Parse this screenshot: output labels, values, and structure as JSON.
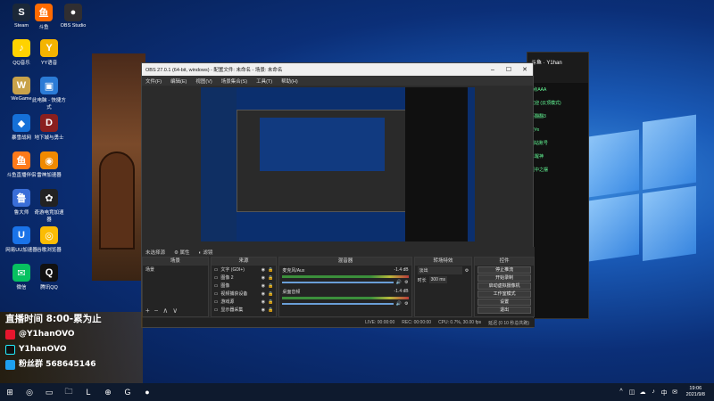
{
  "desktop": {
    "icons": [
      {
        "label": "Steam",
        "glyph": "S",
        "color": "#1b2838"
      },
      {
        "label": "斗鱼",
        "glyph": "鱼",
        "color": "#ff6a00"
      },
      {
        "label": "OBS Studio",
        "glyph": "●",
        "color": "#302e31"
      },
      {
        "label": "QQ音乐",
        "glyph": "♪",
        "color": "#ffd200"
      },
      {
        "label": "YY语音",
        "glyph": "Y",
        "color": "#f4b400"
      },
      {
        "label": "WeGame",
        "glyph": "W",
        "color": "#c8a24a"
      },
      {
        "label": "此电脑 - 快捷方式",
        "glyph": "▣",
        "color": "#2b7bd6"
      },
      {
        "label": "暴雪战网",
        "glyph": "◆",
        "color": "#1570d8"
      },
      {
        "label": "地下城与勇士",
        "glyph": "D",
        "color": "#8a1f1f"
      },
      {
        "label": "斗鱼直播伴侣",
        "glyph": "鱼",
        "color": "#ff7a1a"
      },
      {
        "label": "雷神加速器",
        "glyph": "◉",
        "color": "#f08a00"
      },
      {
        "label": "鲁大师",
        "glyph": "鲁",
        "color": "#3a6ed8"
      },
      {
        "label": "奇游电竞加速器",
        "glyph": "✿",
        "color": "#222"
      },
      {
        "label": "网易UU加速器",
        "glyph": "U",
        "color": "#1a73e8"
      },
      {
        "label": "谷歌浏览器",
        "glyph": "◎",
        "color": "#fbbc05"
      },
      {
        "label": "微信",
        "glyph": "✉",
        "color": "#07c160"
      },
      {
        "label": "腾讯QQ",
        "glyph": "Q",
        "color": "#111"
      }
    ]
  },
  "chat_window": {
    "title": "斗鱼 · Y1han",
    "lines": [
      "A点AAA",
      "欢迎 (云顶模式)",
      "蔡翻翻3",
      "空#x",
      "网站账号",
      "三醒神",
      "驱中之摆"
    ]
  },
  "obs": {
    "title": "OBS 27.0.1 (64-bit, windows) - 配置文件: 未命名 - 场景: 未命名",
    "menu": [
      "文件(F)",
      "编辑(E)",
      "视图(V)",
      "场景集合(S)",
      "工具(T)",
      "帮助(H)"
    ],
    "bar": [
      "未选择源",
      "属性",
      "滤镜"
    ],
    "docks": {
      "scenes": {
        "title": "场景",
        "items": [
          "场景"
        ]
      },
      "sources": {
        "title": "来源",
        "items": [
          "文字 (GDI+)",
          "图像 2",
          "图像",
          "视频捕获设备",
          "游戏源",
          "显示器采集"
        ]
      },
      "mixer": {
        "title": "混音器",
        "channels": [
          {
            "name": "麦克风/Aux",
            "db": "-1.4 dB"
          },
          {
            "name": "桌面音频",
            "db": "-1.4 dB"
          }
        ]
      },
      "transitions": {
        "title": "转场特效",
        "value": "淡出",
        "duration_label": "时长",
        "duration": "300 ms"
      },
      "controls": {
        "title": "控件",
        "buttons": [
          "停止推流",
          "开始录制",
          "启动虚拟摄像机",
          "工作室模式",
          "设置",
          "退出"
        ]
      }
    },
    "status": [
      "LIVE: 00:00:00",
      "REC: 00:00:00",
      "CPU: 0.7%, 30.00 fps",
      "延迟 (0 10 秒总共跑)"
    ]
  },
  "overlay": {
    "title": "直播时间 8:00-累为止",
    "weibo": "@Y1hanOVO",
    "douyin": "Y1hanOVO",
    "fans": "粉丝群 568645146"
  },
  "taskbar": {
    "icons": [
      "⊞",
      "◎",
      "▭",
      "🗀",
      "L",
      "⊕",
      "G",
      "●"
    ],
    "tray": [
      "^",
      "◫",
      "☁",
      "♪",
      "中",
      "✉"
    ],
    "time": "19:06",
    "date": "2021/9/8"
  }
}
